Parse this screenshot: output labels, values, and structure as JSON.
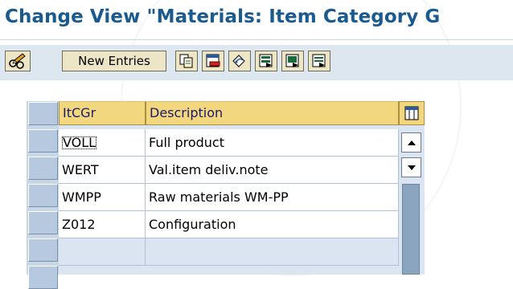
{
  "window": {
    "title": "Change View \"Materials: Item Category G"
  },
  "toolbar": {
    "buttons": [
      {
        "name": "display-change-toggle",
        "icon": "pencil-glasses-icon"
      },
      {
        "name": "new-entries",
        "label": "New Entries"
      },
      {
        "name": "copy-as",
        "icon": "copy-icon"
      },
      {
        "name": "delete",
        "icon": "delete-icon"
      },
      {
        "name": "undo-change",
        "icon": "undo-icon"
      },
      {
        "name": "select-all",
        "icon": "select-all-icon"
      },
      {
        "name": "select-block",
        "icon": "select-block-icon"
      },
      {
        "name": "deselect-all",
        "icon": "deselect-all-icon"
      }
    ]
  },
  "table": {
    "columns": [
      "ItCGr",
      "Description"
    ],
    "rows": [
      {
        "itcgr": "VOLL",
        "description": "Full product"
      },
      {
        "itcgr": "WERT",
        "description": "Val.item deliv.note"
      },
      {
        "itcgr": "WMPP",
        "description": "Raw materials WM-PP"
      },
      {
        "itcgr": "Z012",
        "description": "Configuration"
      },
      {
        "itcgr": "",
        "description": ""
      }
    ]
  },
  "colors": {
    "title": "#1a5a8e",
    "header_bg": "#f3d77e",
    "toolbar_bg": "#dde7f0",
    "grid_bg": "#dbe5f1"
  }
}
